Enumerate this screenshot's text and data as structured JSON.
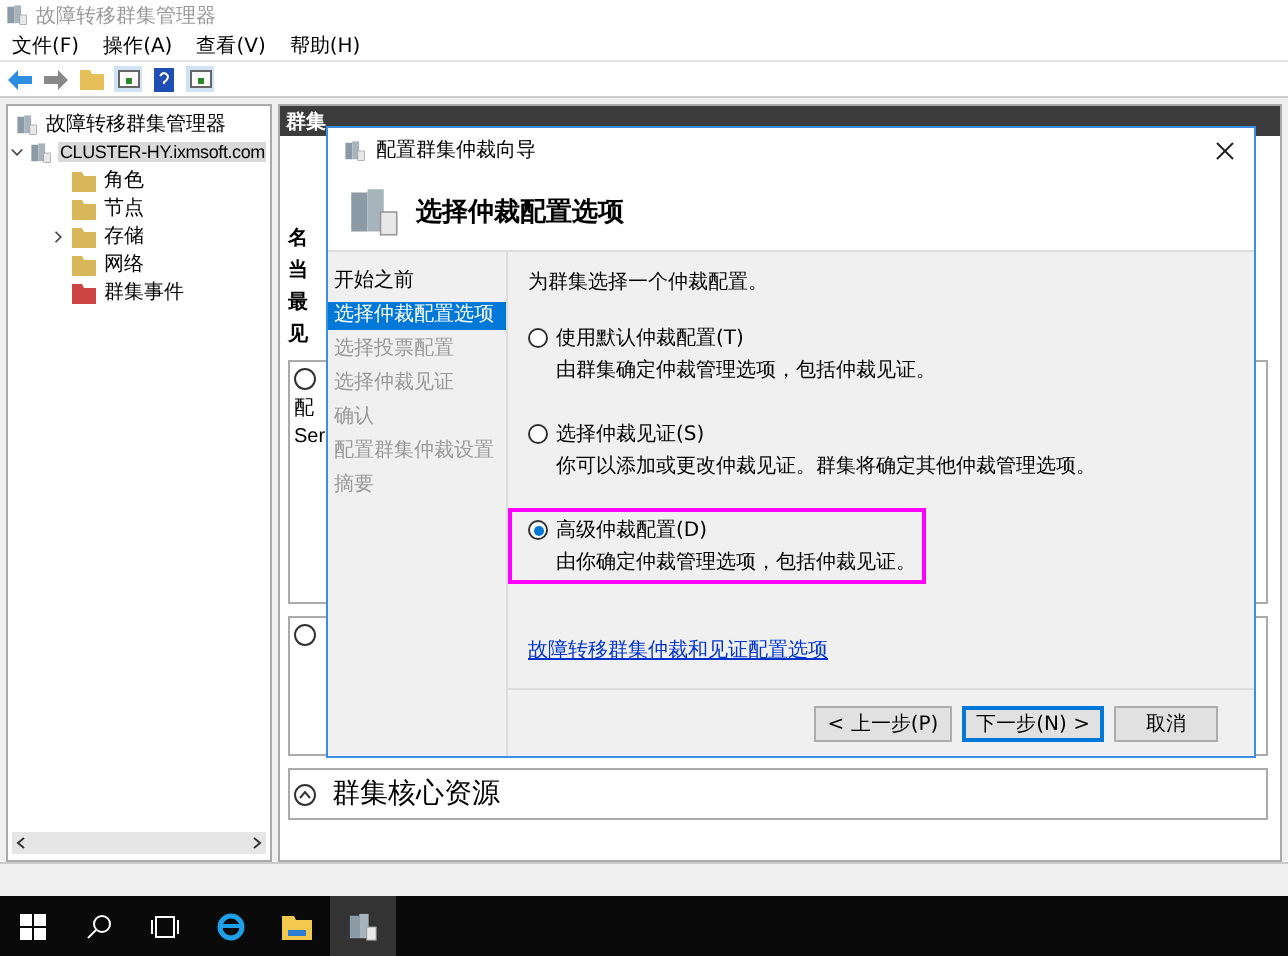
{
  "window": {
    "title": "故障转移群集管理器"
  },
  "menu": [
    "文件(F)",
    "操作(A)",
    "查看(V)",
    "帮助(H)"
  ],
  "tree": {
    "label": "故障转移群集管理器",
    "children": [
      {
        "label": "CLUSTER-HY.ixmsoft.com",
        "expanded": true,
        "selected": true,
        "children": [
          {
            "label": "角色"
          },
          {
            "label": "节点"
          },
          {
            "label": "存储",
            "expanded": false
          },
          {
            "label": "网络"
          },
          {
            "label": "群集事件"
          }
        ]
      }
    ]
  },
  "main_panel": {
    "header": "群集",
    "summary_labels": [
      "名",
      "当",
      "最",
      "见"
    ],
    "section_texts": [
      "配",
      "Ser"
    ],
    "core_resources_title": "群集核心资源"
  },
  "dialog": {
    "title": "配置群集仲裁向导",
    "heading": "选择仲裁配置选项",
    "steps": [
      {
        "label": "开始之前",
        "selected": false,
        "disabled": false
      },
      {
        "label": "选择仲裁配置选项",
        "selected": true,
        "disabled": false
      },
      {
        "label": "选择投票配置",
        "selected": false,
        "disabled": true
      },
      {
        "label": "选择仲裁见证",
        "selected": false,
        "disabled": true
      },
      {
        "label": "确认",
        "selected": false,
        "disabled": true
      },
      {
        "label": "配置群集仲裁设置",
        "selected": false,
        "disabled": true
      },
      {
        "label": "摘要",
        "selected": false,
        "disabled": true
      }
    ],
    "prompt": "为群集选择一个仲裁配置。",
    "options": [
      {
        "label": "使用默认仲裁配置(T)",
        "description": "由群集确定仲裁管理选项，包括仲裁见证。",
        "selected": false,
        "highlighted": false
      },
      {
        "label": "选择仲裁见证(S)",
        "description": "你可以添加或更改仲裁见证。群集将确定其他仲裁管理选项。",
        "selected": false,
        "highlighted": false
      },
      {
        "label": "高级仲裁配置(D)",
        "description": "由你确定仲裁管理选项，包括仲裁见证。",
        "selected": true,
        "highlighted": true
      }
    ],
    "link": "故障转移群集仲裁和见证配置选项",
    "buttons": [
      {
        "label": "< 上一步(P)",
        "default": false
      },
      {
        "label": "下一步(N) >",
        "default": true
      },
      {
        "label": "取消",
        "default": false
      }
    ]
  }
}
